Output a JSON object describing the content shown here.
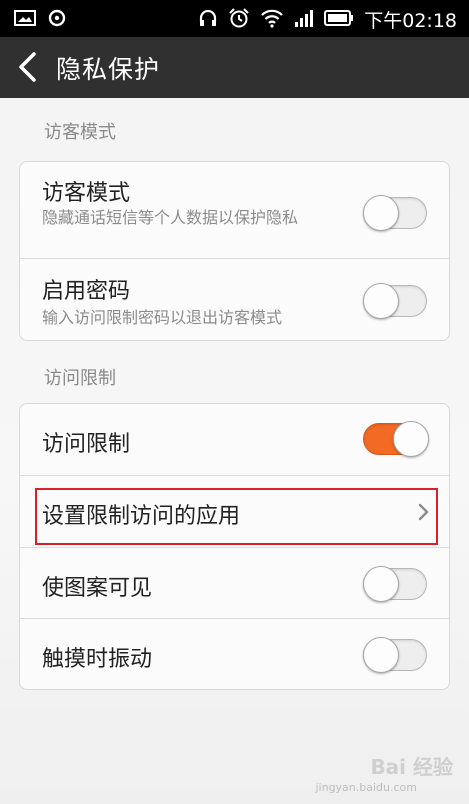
{
  "status_bar": {
    "time": "下午02:18",
    "left_icons": [
      "image-icon",
      "sync-icon"
    ],
    "right_icons": [
      "headphones-icon",
      "alarm-icon",
      "wifi-icon",
      "signal-icon",
      "battery-icon"
    ]
  },
  "header": {
    "title": "隐私保护",
    "back_icon": "back-arrow-icon"
  },
  "sections": {
    "visitor_label": "访客模式",
    "access_label": "访问限制"
  },
  "visitor_card": {
    "visitor_mode": {
      "title": "访客模式",
      "subtitle": "隐藏通话短信等个人数据以保护隐私",
      "enabled": false
    },
    "enable_password": {
      "title": "启用密码",
      "subtitle": "输入访问限制密码以退出访客模式",
      "enabled": false
    }
  },
  "access_card": {
    "access_limit": {
      "title": "访问限制",
      "enabled": true
    },
    "set_apps": {
      "title": "设置限制访问的应用"
    },
    "pattern_visible": {
      "title": "使图案可见",
      "enabled": false
    },
    "touch_vibrate": {
      "title": "触摸时振动",
      "enabled": false
    }
  },
  "watermark": {
    "logo": "Bai 经验",
    "url": "jingyan.baidu.com"
  },
  "colors": {
    "toggle_on": "#f26a24",
    "highlight_box": "#d9202a",
    "title_bar": "#303030"
  }
}
